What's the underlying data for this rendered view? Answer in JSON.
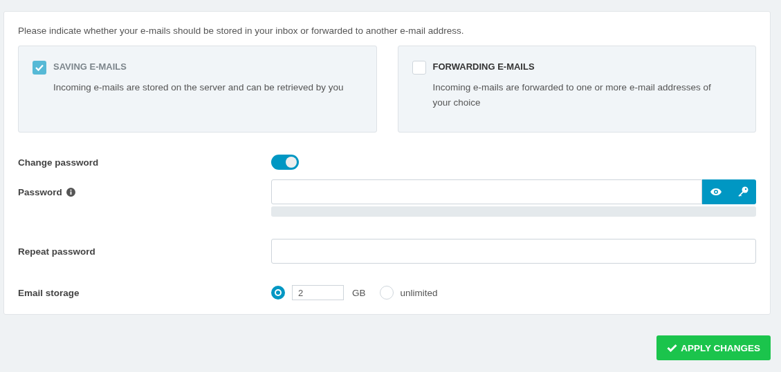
{
  "intro": "Please indicate whether your e-mails should be stored in your inbox or forwarded to another e-mail address.",
  "options": [
    {
      "title": "SAVING E-MAILS",
      "description": "Incoming e-mails are stored on the server and can be retrieved by you",
      "checked": true
    },
    {
      "title": "FORWARDING E-MAILS",
      "description": "Incoming e-mails are forwarded to one or more e-mail addresses of your choice",
      "checked": false
    }
  ],
  "change_password": {
    "label": "Change password",
    "on": true
  },
  "password": {
    "label": "Password",
    "strength": {
      "level": 0
    }
  },
  "repeat_password": {
    "label": "Repeat password"
  },
  "email_storage": {
    "label": "Email storage",
    "choices": [
      {
        "kind": "quota",
        "selected": true,
        "value": "2",
        "unit": "GB"
      },
      {
        "kind": "plain",
        "selected": false,
        "label": "unlimited"
      }
    ]
  },
  "apply_button": {
    "label": "APPLY CHANGES"
  }
}
